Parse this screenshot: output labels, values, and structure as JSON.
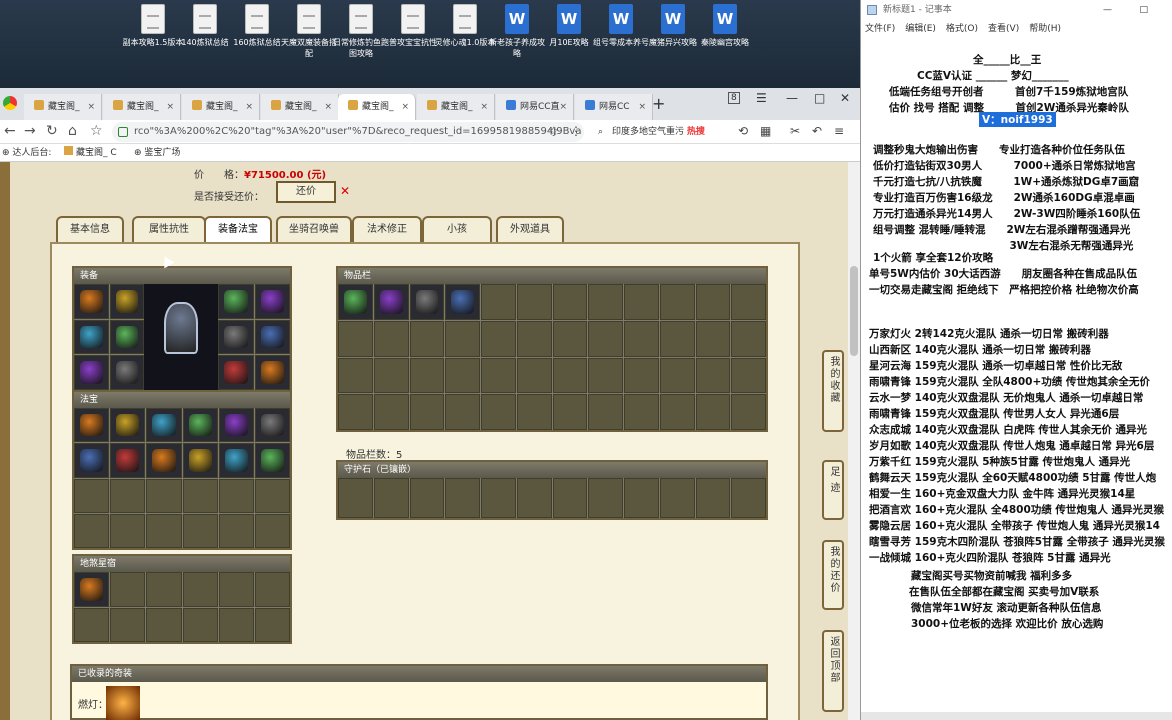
{
  "desktop_icons": [
    "副本攻略1.5版本",
    "140炼狱总结",
    "160炼狱总结",
    "天魔双魔装备搭配",
    "日常修炼钓鱼跑图攻略",
    "普攻宝宝抗性",
    "灵修心魂1.0版本",
    "新老孩子养成攻略",
    "月10E攻略",
    "组号零成本养号",
    "魔猪异兴攻略",
    "秦陵幽宫攻略"
  ],
  "browser": {
    "tabs": [
      "藏宝阁_",
      "藏宝阁_",
      "藏宝阁_",
      "藏宝阁_",
      "藏宝阁_",
      "藏宝阁_",
      "网易CC直",
      "网易CC"
    ],
    "tab_badge": "8",
    "url": "rco\"%3A%200%2C%20\"tag\"%3A%20\"user\"%7D&reco_request_id=1699581988594J9Bva",
    "search_text": "印度多地空气重污",
    "search_hot": "热搜",
    "bookmarks": [
      "达人后台:",
      "藏宝阁_ C",
      "鉴宝广场"
    ]
  },
  "listing": {
    "price_label": "价　　格：",
    "price": "¥71500.00 (元)",
    "haggle_label": "是否接受还价：",
    "haggle_button": "还价",
    "tabs": [
      "基本信息",
      "属性抗性",
      "装备法宝",
      "坐骑召唤兽",
      "法术修正",
      "小孩",
      "外观道具"
    ],
    "sections": {
      "equipment": "装备",
      "treasure": "法宝",
      "star_palace": "地煞星宿",
      "inventory": "物品栏",
      "guard_stone": "守护石（已镶嵌）",
      "collected": "已收录的奇装"
    },
    "inventory_count": "物品栏数：5",
    "lantern_label": "燃灯：",
    "side_buttons": [
      "我的收藏",
      "足迹",
      "我的还价",
      "返回顶部"
    ]
  },
  "notepad": {
    "title": "新标题1 - 记事本",
    "menu": [
      "文件(F)",
      "编辑(E)",
      "格式(O)",
      "查看(V)",
      "帮助(H)"
    ],
    "lines": [
      "全_____比__王",
      "CC蓝V认证 ______ 梦幻_______",
      "低端任务组号开创者　　　首创7千159炼狱地宫队",
      "估价 找号 搭配 调整　　　首创2W通杀异光秦岭队",
      "V：noif1993",
      "调整秒鬼大炮输出伤害　　专业打造各种价位任务队伍",
      "低价打造钻街双30男人　　　7000+通杀日常炼狱地宫",
      "千元打造七抗/八抗铁魔　　　1W+通杀炼狱DG卓7画窟",
      "专业打造百万伤害16级龙　　2W通杀160DG卓混卓画",
      "万元打造通杀异光14男人　　2W-3W四阶睡杀160队伍",
      "组号调整 混转睡/睡转混　　2W左右混杀蹭帮强通异光",
      "　　　　　　　　　　　　　3W左右混杀无帮强通异光",
      "1个火箭 享全套12价攻略",
      "单号5W内估价 30大话西游　　朋友圈各种在售成品队伍",
      "一切交易走藏宝阁 拒绝线下　严格把控价格 杜绝物次价高",
      "万家灯火 2转142克火混队 通杀一切日常 搬砖利器",
      "山西新区 140克火混队 通杀一切日常 搬砖利器",
      "星河云海 159克火混队 通杀一切卓越日常 性价比无敌",
      "雨啸青锋 159克火混队 全队4800+功绩 传世炮其余全无价",
      "云水一梦 140克火双盘混队 无价炮鬼人 通杀一切卓越日常",
      "雨啸青锋 159克火双盘混队 传世男人女人 异光通6层",
      "众志成城 140克火双盘混队 白虎阵 传世人其余无价 通异光",
      "岁月如歌 140克火双盘混队 传世人炮鬼 通卓越日常 异光6层",
      "万紫千红 159克火混队 5种族5甘露 传世炮鬼人 通异光",
      "鹤舞云天 159克火混队 全60天赋4800功绩 5甘露 传世人炮",
      "相爱一生 160+克金双盘大力队 金牛阵 通异光灵猴14星",
      "把酒言欢 160+克火混队 全4800功绩 传世炮鬼人 通异光灵猴",
      "雾隐云居 160+克火混队 全带孩子 传世炮人鬼 通异光灵猴14",
      "瞎雪寻芳 159克木四阶混队 苍狼阵5甘露 全带孩子 通异光灵猴",
      "一战倾城 160+克火四阶混队 苍狼阵 5甘露 通异光",
      "藏宝阁买号买物资前喊我 福利多多",
      "在售队伍全部都在藏宝阁 买卖号加V联系",
      "微信常年1W好友 滚动更新各种队伍信息",
      "3000+位老板的选择 欢迎比价 放心选购"
    ]
  },
  "colors": {
    "accent": "#1e6fd9",
    "price": "#cc0000",
    "frame": "#7c6538"
  }
}
